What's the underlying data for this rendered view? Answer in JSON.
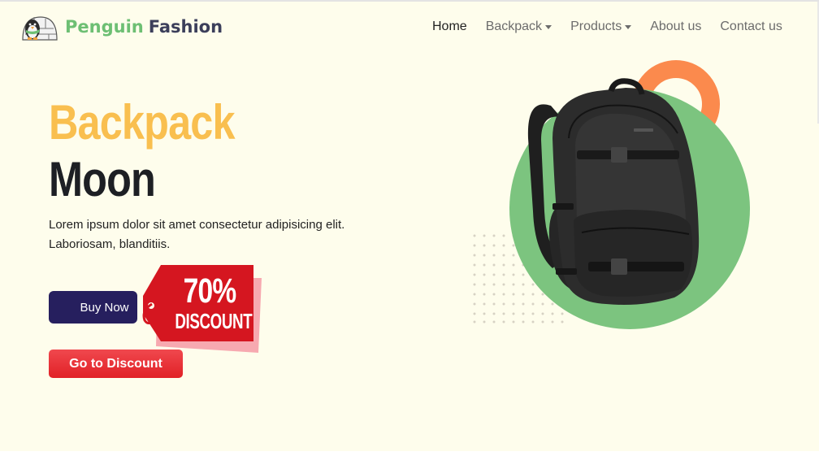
{
  "nav": {
    "brand_part1": "Penguin",
    "brand_part2": "Fashion",
    "items": [
      {
        "label": "Home",
        "dropdown": false,
        "active": true
      },
      {
        "label": "Backpack",
        "dropdown": true
      },
      {
        "label": "Products",
        "dropdown": true
      },
      {
        "label": "About us",
        "dropdown": false
      },
      {
        "label": "Contact us",
        "dropdown": false
      }
    ]
  },
  "hero": {
    "title_line1": "Backpack",
    "title_line2": "Moon",
    "description": "Lorem ipsum dolor sit amet consectetur adipisicing elit. Laboriosam, blanditiis.",
    "buy_label": "Buy Now",
    "tag_percent": "70%",
    "tag_word": "DISCOUNT",
    "discount_button_label": "Go to Discount"
  },
  "colors": {
    "background": "#fefdec",
    "brand_green": "#6dbf73",
    "brand_dark": "#3b3e5a",
    "title_yellow": "#f9bf4f",
    "buy_button": "#261f5e",
    "discount_red": "#e12126",
    "circle_green": "#7cc47f",
    "ring_orange": "#fb8a4d"
  },
  "icons": {
    "logo": "penguin-igloo-icon",
    "product": "backpack-image"
  }
}
